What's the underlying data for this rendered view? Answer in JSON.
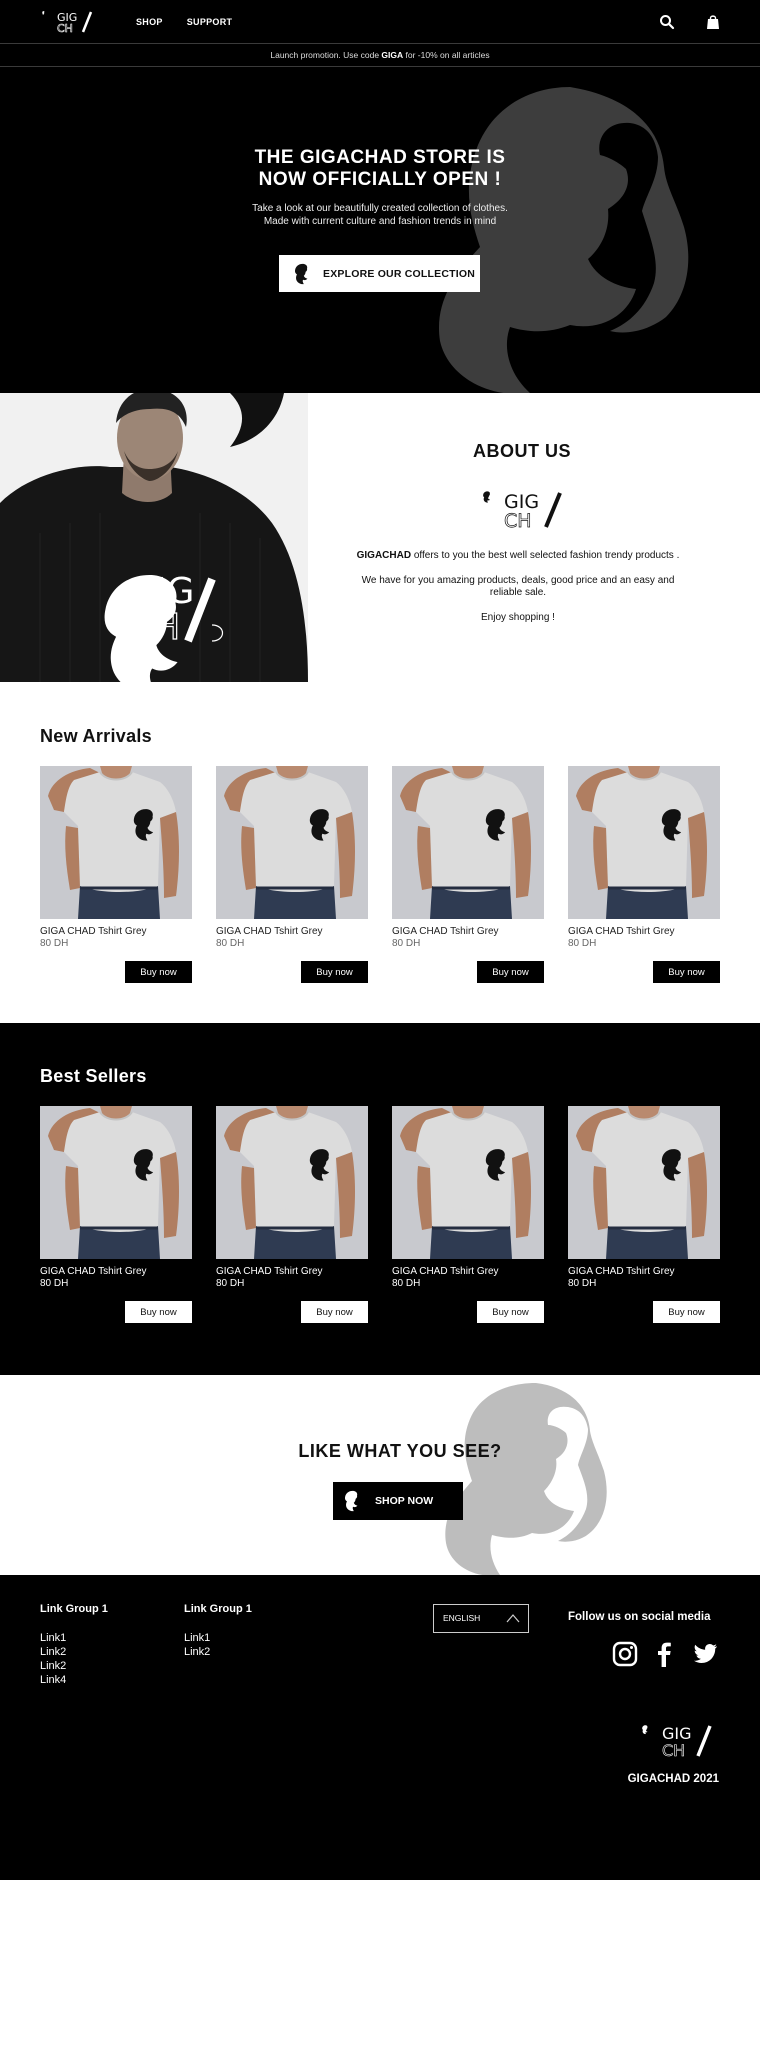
{
  "nav": {
    "logo": "GIGACHAD",
    "links": [
      "SHOP",
      "SUPPORT"
    ],
    "search_icon": "search-icon",
    "bag_icon": "shopping-bag-icon"
  },
  "promo": {
    "prefix": "Launch promotion. Use code ",
    "code": "GIGA",
    "suffix": " for -10% on all articles"
  },
  "hero": {
    "title_line1": "THE GIGACHAD STORE IS",
    "title_line2": "NOW OFFICIALLY OPEN !",
    "sub_line1": "Take a look at our beautifully created collection of clothes.",
    "sub_line2": "Made with current culture and fashion trends in mind",
    "button": "EXPLORE OUR COLLECTION"
  },
  "about": {
    "title": "ABOUT US",
    "brand": "GIGACHAD",
    "p1_rest": " offers to you the best well selected fashion trendy products .",
    "p2": "We have for you amazing products, deals, good price and an easy and reliable sale.",
    "p3": "Enjoy shopping !"
  },
  "new_arrivals": {
    "title": "New Arrivals",
    "products": [
      {
        "name": "GIGA CHAD Tshirt Grey",
        "price": "80 DH",
        "button": "Buy now"
      },
      {
        "name": "GIGA CHAD Tshirt Grey",
        "price": "80 DH",
        "button": "Buy now"
      },
      {
        "name": "GIGA CHAD Tshirt Grey",
        "price": "80 DH",
        "button": "Buy now"
      },
      {
        "name": "GIGA CHAD Tshirt Grey",
        "price": "80 DH",
        "button": "Buy now"
      }
    ]
  },
  "best_sellers": {
    "title": "Best Sellers",
    "products": [
      {
        "name": "GIGA CHAD Tshirt Grey",
        "price": "80 DH",
        "button": "Buy now"
      },
      {
        "name": "GIGA CHAD Tshirt Grey",
        "price": "80 DH",
        "button": "Buy now"
      },
      {
        "name": "GIGA CHAD Tshirt Grey",
        "price": "80 DH",
        "button": "Buy now"
      },
      {
        "name": "GIGA CHAD Tshirt Grey",
        "price": "80 DH",
        "button": "Buy now"
      }
    ]
  },
  "cta": {
    "title": "LIKE WHAT YOU SEE?",
    "button": "SHOP NOW"
  },
  "footer": {
    "group1": {
      "title": "Link Group 1",
      "links": [
        "Link1",
        "Link2",
        "Link2",
        "Link4"
      ]
    },
    "group2": {
      "title": "Link Group 1",
      "links": [
        "Link1",
        "Link2"
      ]
    },
    "language": "ENGLISH",
    "follow": "Follow us on social media",
    "social": [
      "instagram-icon",
      "facebook-icon",
      "twitter-icon"
    ],
    "copyright": "GIGACHAD 2021"
  },
  "colors": {
    "black": "#000000",
    "white": "#ffffff",
    "silhouette_dark": "#3d3d3d",
    "silhouette_light": "#bdbdbd",
    "shirt_bg": "#c8c9ce"
  }
}
